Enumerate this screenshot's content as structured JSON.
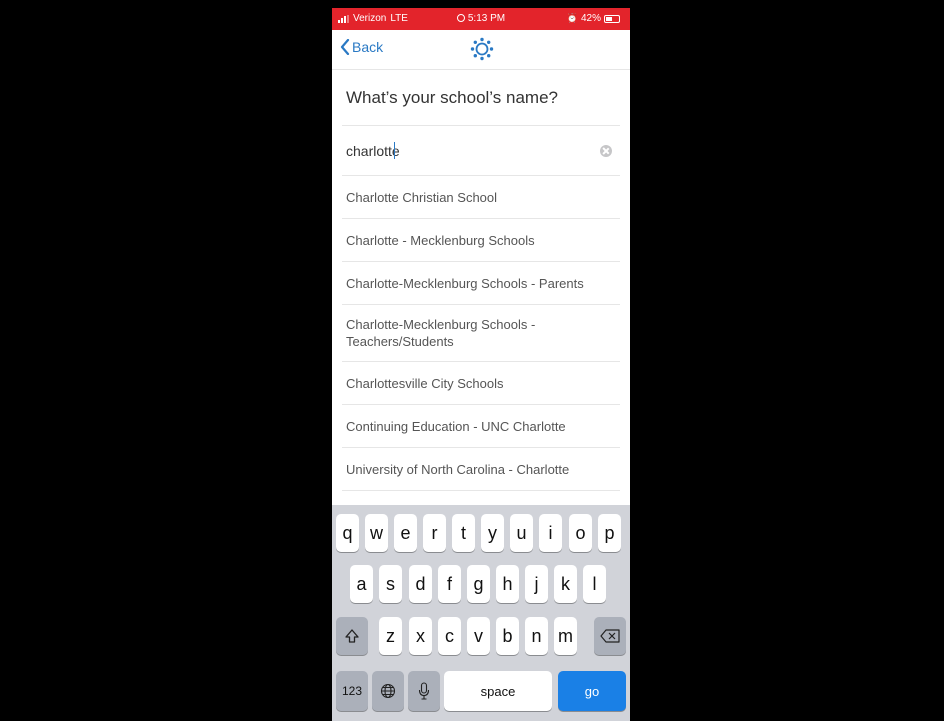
{
  "status_bar": {
    "carrier": "Verizon",
    "network": "LTE",
    "time": "5:13 PM",
    "battery": "42%"
  },
  "nav": {
    "back_label": "Back",
    "logo_icon": "canvas-logo-icon",
    "accent_color": "#2a79c4"
  },
  "page": {
    "title": "What’s your school’s name?"
  },
  "search": {
    "value": "charlotte"
  },
  "results": [
    "Charlotte Christian School",
    "Charlotte - Mecklenburg Schools",
    "Charlotte-Mecklenburg Schools - Parents",
    "Charlotte-Mecklenburg Schools - Teachers/Students",
    "Charlottesville City Schools",
    "Continuing Education - UNC Charlotte",
    "University of North Carolina - Charlotte"
  ],
  "keyboard": {
    "row1": [
      "q",
      "w",
      "e",
      "r",
      "t",
      "y",
      "u",
      "i",
      "o",
      "p"
    ],
    "row2": [
      "a",
      "s",
      "d",
      "f",
      "g",
      "h",
      "j",
      "k",
      "l"
    ],
    "row3": [
      "z",
      "x",
      "c",
      "v",
      "b",
      "n",
      "m"
    ],
    "numbers_label": "123",
    "space_label": "space",
    "go_label": "go",
    "go_color": "#1a80e6"
  }
}
